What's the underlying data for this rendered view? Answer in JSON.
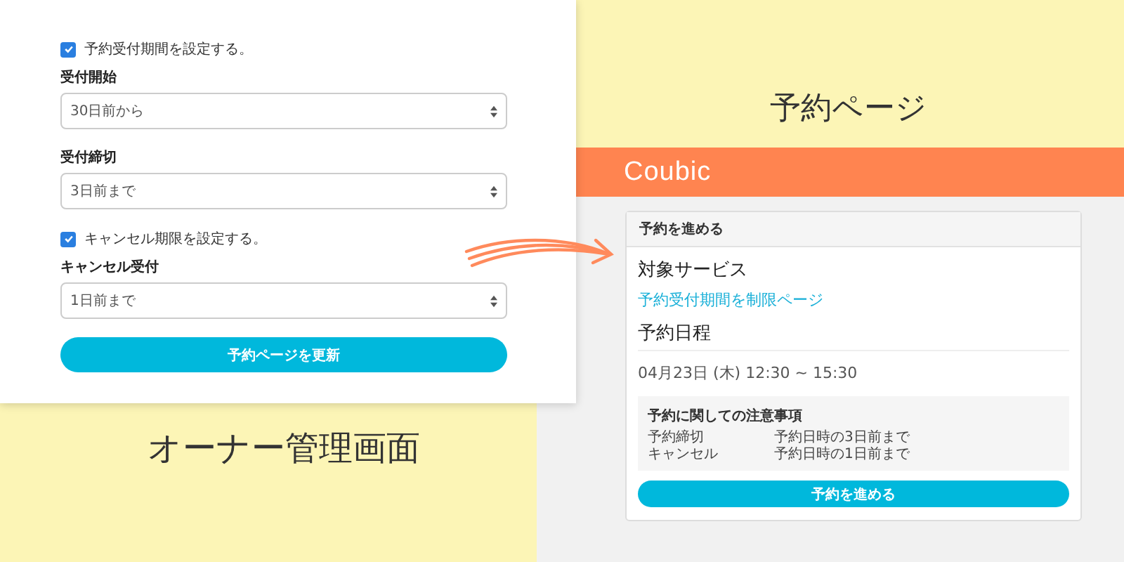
{
  "owner_panel": {
    "caption": "オーナー管理画面",
    "items": [
      {
        "kind": "checkbox",
        "label": "予約受付期間を設定する。",
        "checked": true
      },
      {
        "kind": "select",
        "label": "受付開始",
        "value": "30日前から"
      },
      {
        "kind": "select",
        "label": "受付締切",
        "value": "3日前まで"
      },
      {
        "kind": "checkbox",
        "label": "キャンセル期限を設定する。",
        "checked": true
      },
      {
        "kind": "select",
        "label": "キャンセル受付",
        "value": "1日前まで"
      }
    ],
    "button": "予約ページを更新"
  },
  "booking_page": {
    "caption": "予約ページ",
    "logo": "Coubic",
    "card": {
      "header": "予約を進める",
      "service_heading": "対象サービス",
      "service_link": "予約受付期間を制限ページ",
      "schedule_heading": "予約日程",
      "schedule": "04月23日 (木) 12:30 ~ 15:30",
      "notes": {
        "title": "予約に関しての注意事項",
        "rows": [
          {
            "label": "予約締切",
            "value": "予約日時の3日前まで"
          },
          {
            "label": "キャンセル",
            "value": "予約日時の1日前まで"
          }
        ]
      },
      "button": "予約を進める"
    }
  }
}
